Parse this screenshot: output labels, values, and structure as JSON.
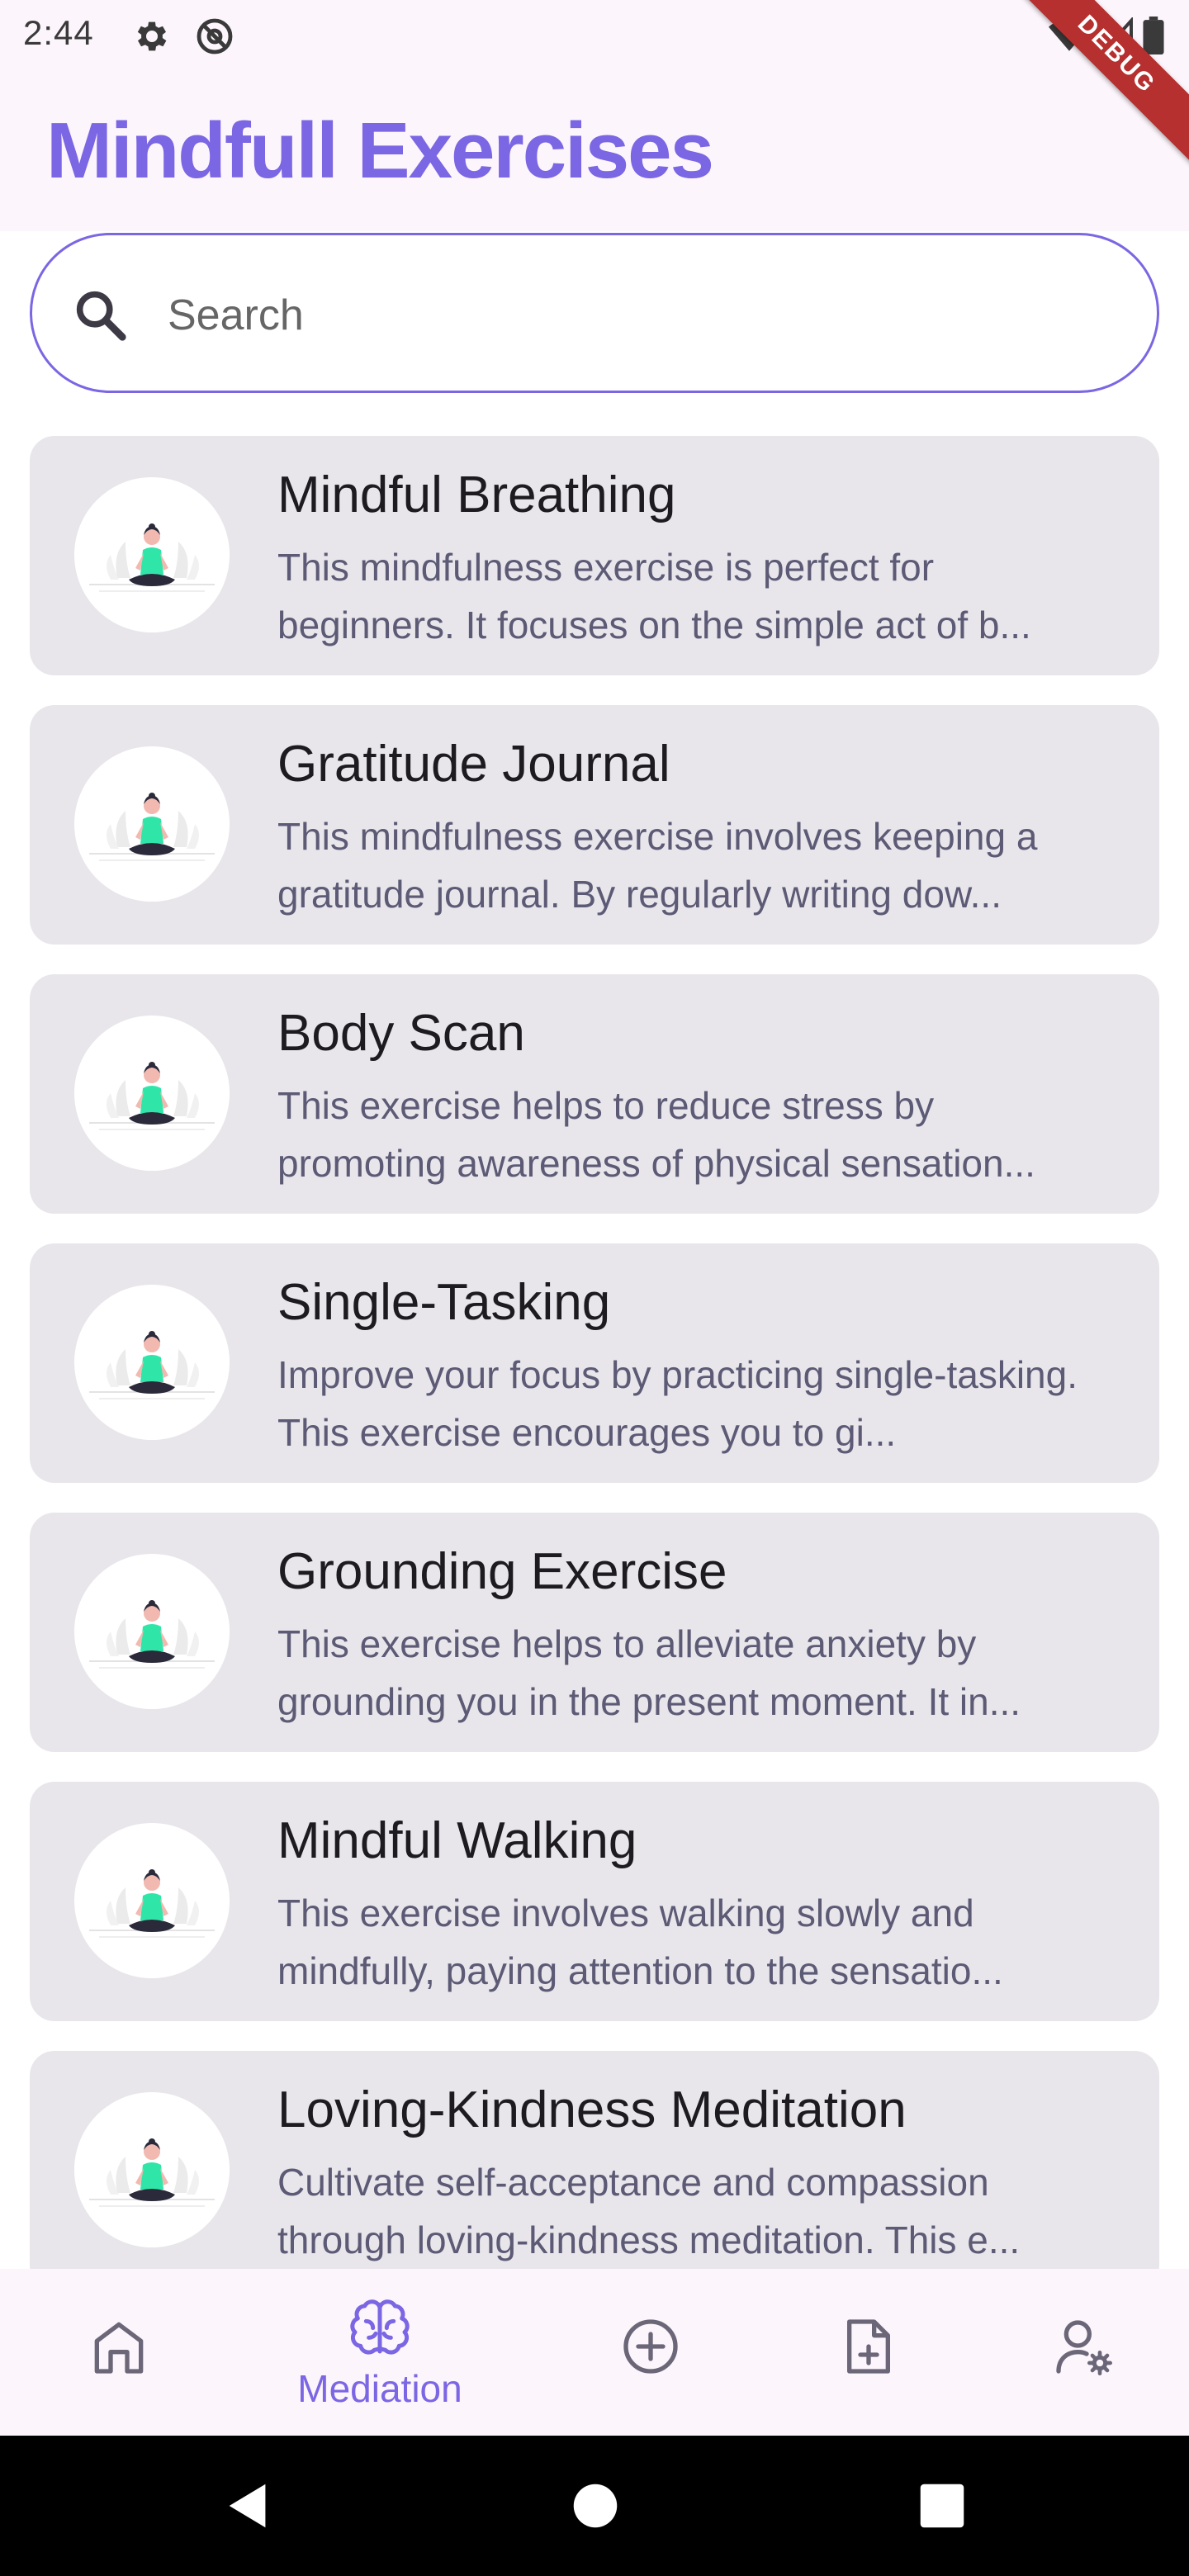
{
  "status_bar": {
    "time": "2:44",
    "icons": [
      "gear-icon",
      "at-sign-icon",
      "wifi-icon",
      "signal-icon",
      "battery-icon"
    ]
  },
  "debug_banner": "DEBUG",
  "app_bar": {
    "title": "Mindfull Exercises"
  },
  "search": {
    "placeholder": "Search",
    "value": ""
  },
  "exercises": [
    {
      "title": "Mindful Breathing",
      "description": "This mindfulness exercise is perfect for beginners. It focuses on the simple act of b..."
    },
    {
      "title": "Gratitude Journal",
      "description": "This mindfulness exercise involves keeping a gratitude journal. By regularly writing dow..."
    },
    {
      "title": "Body Scan",
      "description": "This exercise helps to reduce stress by promoting awareness of physical sensation..."
    },
    {
      "title": "Single-Tasking",
      "description": "Improve your focus by practicing single-tasking. This exercise encourages you to gi..."
    },
    {
      "title": "Grounding Exercise",
      "description": "This exercise helps to alleviate anxiety by grounding you in the present moment. It in..."
    },
    {
      "title": "Mindful Walking",
      "description": "This exercise involves walking slowly and mindfully, paying attention to the sensatio..."
    },
    {
      "title": "Loving-Kindness Meditation",
      "description": "Cultivate self-acceptance and compassion through loving-kindness meditation. This e..."
    }
  ],
  "bottom_nav": {
    "items": [
      {
        "icon": "home-icon",
        "label": "",
        "active": false
      },
      {
        "icon": "brain-icon",
        "label": "Mediation",
        "active": true
      },
      {
        "icon": "add-circle-icon",
        "label": "",
        "active": false
      },
      {
        "icon": "add-document-icon",
        "label": "",
        "active": false
      },
      {
        "icon": "user-settings-icon",
        "label": "",
        "active": false
      }
    ]
  },
  "colors": {
    "accent": "#7b66e3",
    "card_bg": "#e8e6eb",
    "app_bar_bg": "#fdf5fc",
    "figure_green": "#2fe6a8"
  }
}
